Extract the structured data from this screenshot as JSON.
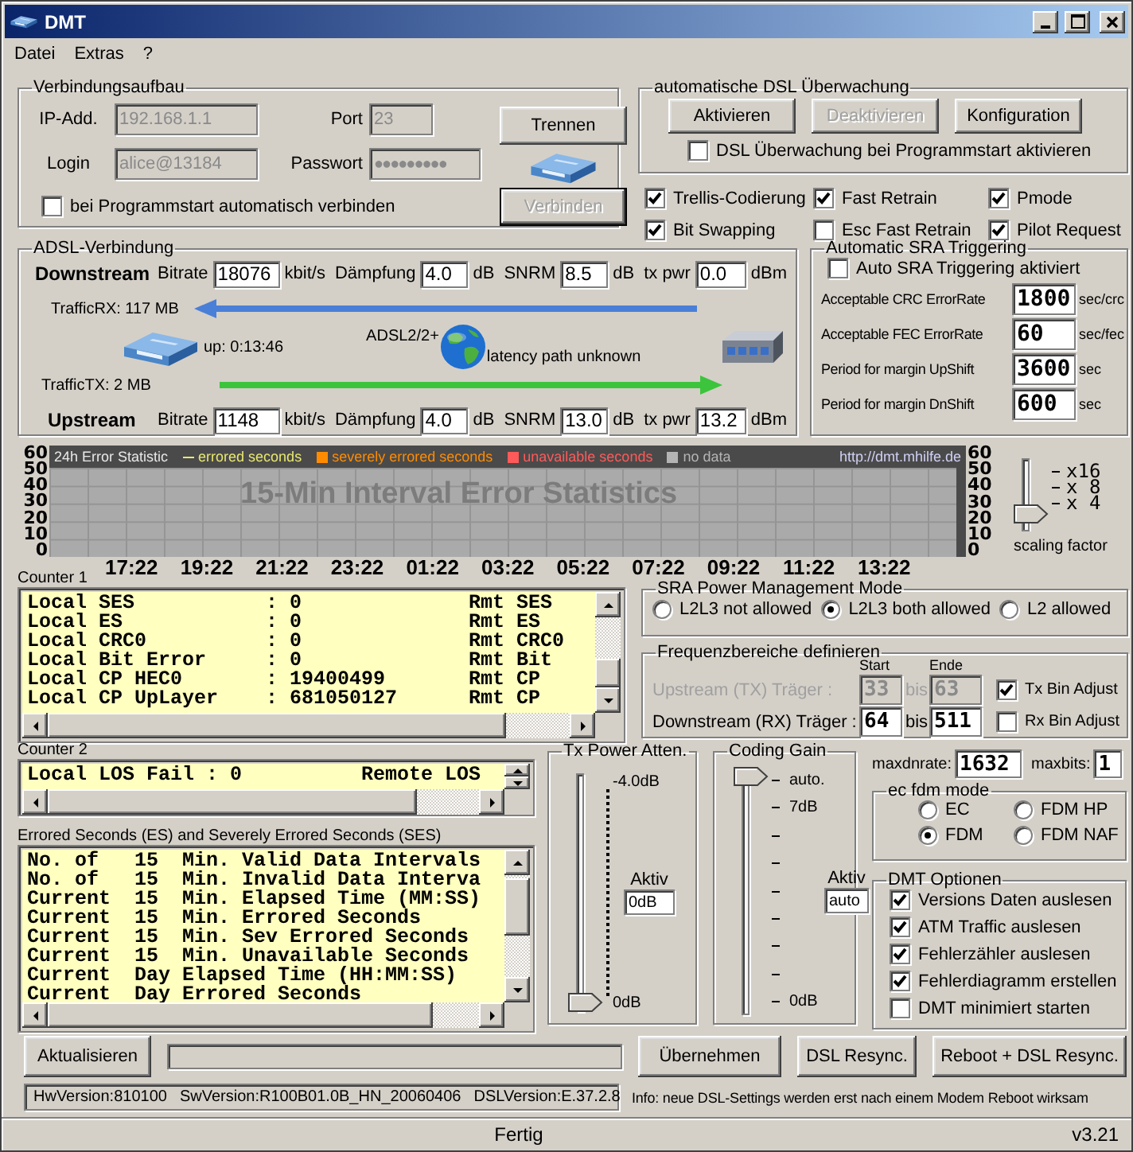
{
  "window": {
    "title": "DMT"
  },
  "menu": [
    "Datei",
    "Extras",
    "?"
  ],
  "connection": {
    "title": "Verbindungsaufbau",
    "fields": [
      {
        "label": "IP-Add.",
        "value": "192.168.1.1",
        "disabled": true
      },
      {
        "label": "Port",
        "value": "23",
        "disabled": true
      },
      {
        "label": "Login",
        "value": "alice@13184",
        "disabled": true
      },
      {
        "label": "Passwort",
        "value": "●●●●●●●●●",
        "disabled": true
      }
    ],
    "autoconnect": {
      "label": "bei Programmstart automatisch verbinden",
      "checked": false
    },
    "buttons": [
      {
        "label": "Trennen",
        "disabled": false
      },
      {
        "label": "Verbinden",
        "disabled": true
      }
    ]
  },
  "monitoring": {
    "title": "automatische DSL Überwachung",
    "buttons": [
      {
        "label": "Aktivieren",
        "disabled": false
      },
      {
        "label": "Deaktivieren",
        "disabled": true
      },
      {
        "label": "Konfiguration",
        "disabled": false
      }
    ],
    "startup": {
      "label": "DSL Überwachung bei Programmstart aktivieren",
      "checked": false
    }
  },
  "options": [
    {
      "label": "Trellis-Codierung",
      "checked": true
    },
    {
      "label": "Fast Retrain",
      "checked": true
    },
    {
      "label": "Pmode",
      "checked": true
    },
    {
      "label": "Bit Swapping",
      "checked": true
    },
    {
      "label": "Esc Fast Retrain",
      "checked": false
    },
    {
      "label": "Pilot Request",
      "checked": true
    }
  ],
  "adsl": {
    "title": "ADSL-Verbindung",
    "downstream": {
      "label": "Downstream",
      "fields": [
        {
          "label": "Bitrate",
          "value": "18076",
          "unit": "kbit/s"
        },
        {
          "label": "Dämpfung",
          "value": "4.0",
          "unit": "dB"
        },
        {
          "label": "SNRM",
          "value": "8.5",
          "unit": "dB"
        },
        {
          "label": "tx pwr",
          "value": "0.0",
          "unit": "dBm"
        }
      ]
    },
    "traffic_rx": "TrafficRX: 117 MB",
    "uptime": "up: 0:13:46",
    "mode": "ADSL2/2+",
    "latency": "latency path unknown",
    "traffic_tx": "TrafficTX: 2 MB",
    "upstream": {
      "label": "Upstream",
      "fields": [
        {
          "label": "Bitrate",
          "value": "1148",
          "unit": "kbit/s"
        },
        {
          "label": "Dämpfung",
          "value": "4.0",
          "unit": "dB"
        },
        {
          "label": "SNRM",
          "value": "13.0",
          "unit": "dB"
        },
        {
          "label": "tx pwr",
          "value": "13.2",
          "unit": "dBm"
        }
      ]
    }
  },
  "sra": {
    "title": "Automatic SRA Triggering",
    "auto": {
      "label": "Auto SRA Triggering aktiviert",
      "checked": false
    },
    "rows": [
      {
        "label": "Acceptable CRC ErrorRate",
        "value": "1800",
        "unit": "sec/crc"
      },
      {
        "label": "Acceptable FEC ErrorRate",
        "value": "60",
        "unit": "sec/fec"
      },
      {
        "label": "Period for margin UpShift",
        "value": "3600",
        "unit": "sec"
      },
      {
        "label": "Period for margin DnShift",
        "value": "600",
        "unit": "sec"
      }
    ]
  },
  "error_chart": {
    "chart_data": {
      "type": "bar",
      "title": "24h Error Statistic",
      "categories": [
        "17:22",
        "19:22",
        "21:22",
        "23:22",
        "01:22",
        "03:22",
        "05:22",
        "07:22",
        "09:22",
        "11:22",
        "13:22"
      ],
      "ylim": [
        0,
        60
      ],
      "yticks": [
        0,
        10,
        20,
        30,
        40,
        50,
        60
      ],
      "series": [
        {
          "name": "errored seconds",
          "color": "#e8e870",
          "marker": "line",
          "values": [
            null,
            null,
            null,
            null,
            null,
            null,
            null,
            null,
            null,
            null,
            null
          ]
        },
        {
          "name": "severely errored seconds",
          "color": "#ff8c00",
          "marker": "square",
          "values": [
            null,
            null,
            null,
            null,
            null,
            null,
            null,
            null,
            null,
            null,
            null
          ]
        },
        {
          "name": "unavailable seconds",
          "color": "#ff5a5a",
          "marker": "square",
          "values": [
            null,
            null,
            null,
            null,
            null,
            null,
            null,
            null,
            null,
            null,
            null
          ]
        },
        {
          "name": "no data",
          "color": "#b4b4b4",
          "marker": "square",
          "values": [
            null,
            null,
            null,
            null,
            null,
            null,
            null,
            null,
            null,
            null,
            null
          ]
        }
      ],
      "grid": true,
      "annotations": [
        {
          "text": "http://dmt.mhilfe.de"
        },
        {
          "text": "15-Min Interval Error Statistics"
        }
      ]
    },
    "left_axis_labels": [
      "60",
      "50",
      "40",
      "30",
      "20",
      "10",
      "0"
    ]
  },
  "scaling": {
    "label": "scaling factor",
    "ticks": [
      "x16",
      "x 8",
      "x 4"
    ],
    "level": 0.15
  },
  "counter1": {
    "title": "Counter 1",
    "lines": [
      "Local SES           : 0              Rmt SES",
      "Local ES            : 0              Rmt ES",
      "Local CRC0          : 0              Rmt CRC0",
      "Local Bit Error     : 0              Rmt Bit",
      "Local CP HEC0       : 19400499       Rmt CP",
      "Local CP UpLayer    : 681050127      Rmt CP"
    ]
  },
  "power_mode": {
    "title": "SRA Power Management Mode",
    "options": [
      {
        "label": "L2L3 not allowed",
        "selected": false
      },
      {
        "label": "L2L3 both allowed",
        "selected": true
      },
      {
        "label": "L2 allowed",
        "selected": false
      }
    ]
  },
  "frequencies": {
    "title": "Frequenzbereiche definieren",
    "start_label": "Start",
    "end_label": "Ende",
    "rows": [
      {
        "label": "Upstream (TX) Träger :",
        "start": "33",
        "separator": "bis",
        "end": "63",
        "disabled": true,
        "adjust": {
          "label": "Tx Bin Adjust",
          "checked": true
        }
      },
      {
        "label": "Downstream (RX) Träger :",
        "start": "64",
        "separator": "bis",
        "end": "511",
        "disabled": false,
        "adjust": {
          "label": "Rx Bin Adjust",
          "checked": false
        }
      }
    ]
  },
  "counter2": {
    "title": "Counter 2",
    "lines": [
      "Local LOS Fail : 0          Remote LOS"
    ]
  },
  "errored_seconds": {
    "title": "Errored Seconds (ES) and Severely Errored Seconds (SES)",
    "lines": [
      "No. of   15  Min. Valid Data Intervals",
      "No. of   15  Min. Invalid Data Interva",
      "Current  15  Min. Elapsed Time (MM:SS)",
      "Current  15  Min. Errored Seconds",
      "Current  15  Min. Sev Errored Seconds",
      "Current  15  Min. Unavailable Seconds",
      "Current  Day Elapsed Time (HH:MM:SS)",
      "Current  Day Errored Seconds"
    ]
  },
  "tx_power": {
    "title": "Tx Power Atten.",
    "top_label": "-4.0dB",
    "bottom_label": "0dB",
    "level": 0,
    "active_label": "Aktiv",
    "active_value": "0dB"
  },
  "coding_gain": {
    "title": "Coding Gain",
    "top_labels": [
      "auto.",
      "7dB"
    ],
    "bottom_label": "0dB",
    "level": 1,
    "active_label": "Aktiv",
    "active_value": "auto"
  },
  "maxdnrate": {
    "label": "maxdnrate:",
    "value": "1632"
  },
  "maxbits": {
    "label": "maxbits:",
    "value": "1"
  },
  "fdm_mode": {
    "title": "ec fdm mode",
    "options": [
      {
        "label": "EC",
        "selected": false
      },
      {
        "label": "FDM HP",
        "selected": false
      },
      {
        "label": "FDM",
        "selected": true
      },
      {
        "label": "FDM NAF",
        "selected": false
      }
    ]
  },
  "dmt_options": {
    "title": "DMT Optionen",
    "items": [
      {
        "label": "Versions Daten auslesen",
        "checked": true
      },
      {
        "label": "ATM Traffic auslesen",
        "checked": true
      },
      {
        "label": "Fehlerzähler auslesen",
        "checked": true
      },
      {
        "label": "Fehlerdiagramm erstellen",
        "checked": true
      },
      {
        "label": "DMT minimiert starten",
        "checked": false
      }
    ]
  },
  "actions": {
    "refresh": "Aktualisieren",
    "progress": {
      "level": 0
    },
    "buttons": [
      "Übernehmen",
      "DSL Resync.",
      "Reboot + DSL Resync."
    ]
  },
  "versions": [
    "HwVersion:810100",
    "SwVersion:R100B01.0B_HN_20060406",
    "DSLVersion:E.37.2.8"
  ],
  "info": "Info: neue DSL-Settings werden erst nach einem Modem Reboot wirksam",
  "status_bar": {
    "text": "Fertig",
    "version": "v3.21"
  }
}
